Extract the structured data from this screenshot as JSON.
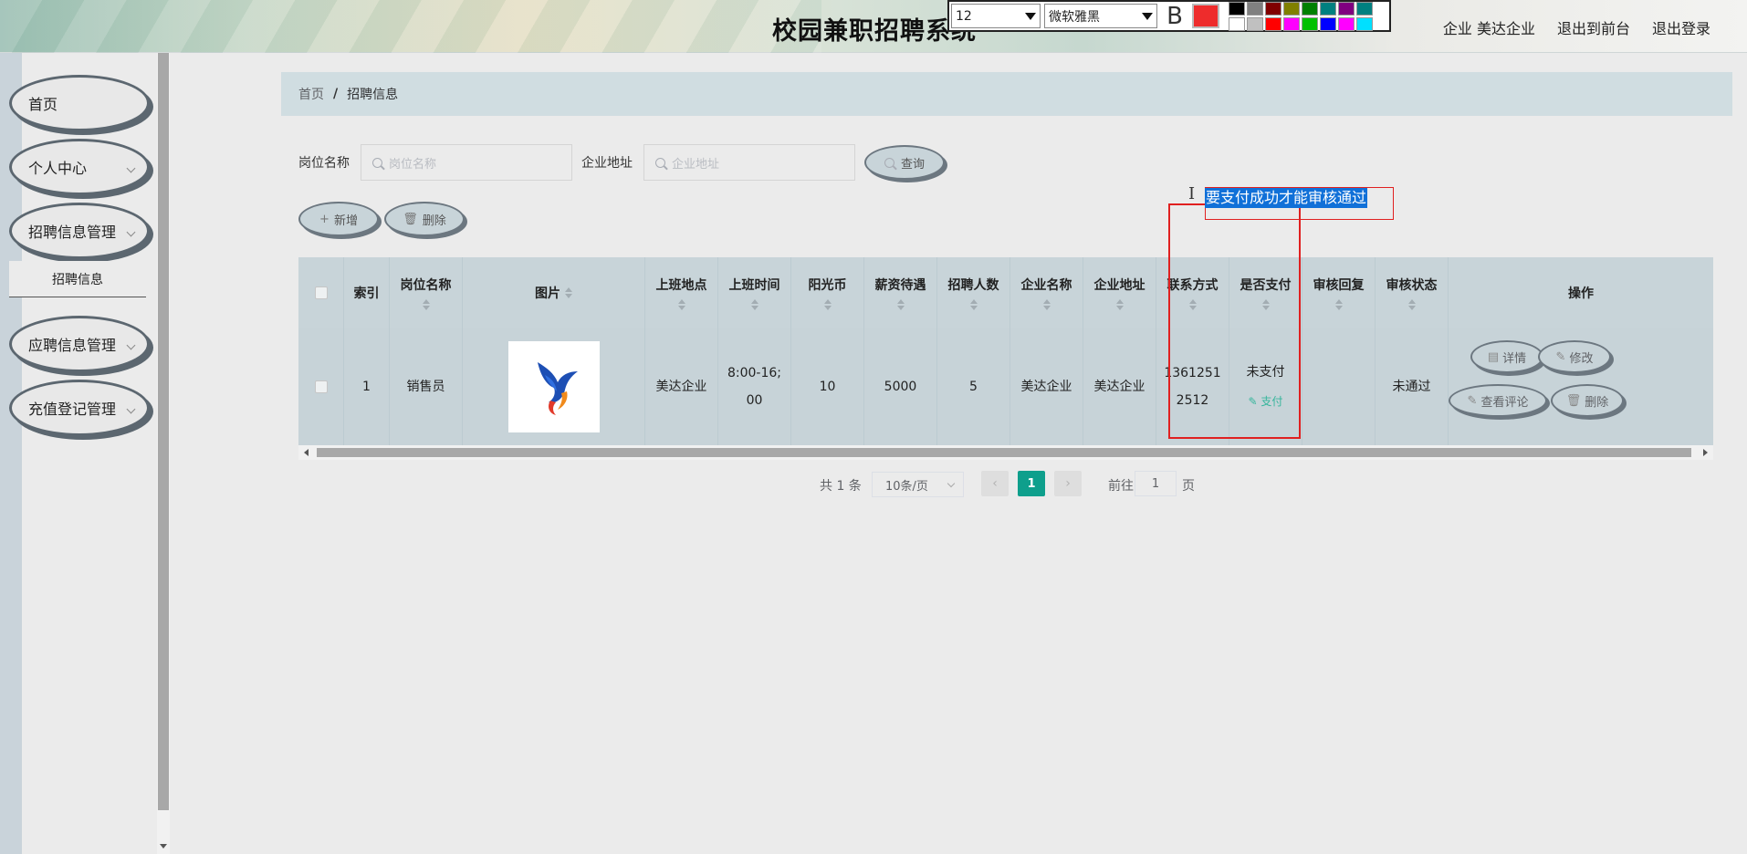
{
  "header": {
    "title": "校园兼职招聘系统",
    "user_label": "企业 美达企业",
    "to_front_label": "退出到前台",
    "logout_label": "退出登录"
  },
  "editor_toolbar": {
    "font_size": "12",
    "font_family": "微软雅黑",
    "bold_label": "B",
    "current_color": "#ee2c2c",
    "palette": [
      "#000000",
      "#808080",
      "#800000",
      "#808000",
      "#008000",
      "#008080",
      "#800080",
      "#008080",
      "#ffffff",
      "#c0c0c0",
      "#ff0000",
      "#ff00ff",
      "#00c000",
      "#0000ff",
      "#ff00ff",
      "#00e0ff"
    ]
  },
  "sidebar": {
    "items": [
      {
        "label": "首页",
        "has_chevron": false
      },
      {
        "label": "个人中心",
        "has_chevron": true
      },
      {
        "label": "招聘信息管理",
        "has_chevron": true
      },
      {
        "label": "应聘信息管理",
        "has_chevron": true
      },
      {
        "label": "充值登记管理",
        "has_chevron": true
      }
    ],
    "submenu": {
      "label": "招聘信息"
    }
  },
  "breadcrumb": {
    "home": "首页",
    "separator": "/",
    "current": "招聘信息"
  },
  "search": {
    "job_label": "岗位名称",
    "job_placeholder": "岗位名称",
    "address_label": "企业地址",
    "address_placeholder": "企业地址",
    "query_button": "查询"
  },
  "actions": {
    "add": "新增",
    "delete": "删除"
  },
  "table": {
    "columns": [
      "索引",
      "岗位名称",
      "图片",
      "上班地点",
      "上班时间",
      "阳光币",
      "薪资待遇",
      "招聘人数",
      "企业名称",
      "企业地址",
      "联系方式",
      "是否支付",
      "审核回复",
      "审核状态",
      "操作"
    ],
    "rows": [
      {
        "index": "1",
        "job_name": "销售员",
        "image": "phoenix-logo",
        "location": "美达企业",
        "work_time_line1": "8:00-16;",
        "work_time_line2": "00",
        "sunshine_coins": "10",
        "salary": "5000",
        "headcount": "5",
        "company_name": "美达企业",
        "company_address": "美达企业",
        "phone_line1": "1361251",
        "phone_line2": "2512",
        "pay_status": "未支付",
        "pay_link": "支付",
        "audit_reply": "",
        "audit_status": "未通过",
        "ops": {
          "detail": "详情",
          "edit": "修改",
          "comments": "查看评论",
          "delete": "删除"
        }
      }
    ]
  },
  "pagination": {
    "total": "共 1 条",
    "page_size": "10条/页",
    "current_page": "1",
    "goto_prefix": "前往",
    "goto_value": "1",
    "goto_suffix": "页"
  },
  "annotation": {
    "note": "要支付成功才能审核通过"
  }
}
